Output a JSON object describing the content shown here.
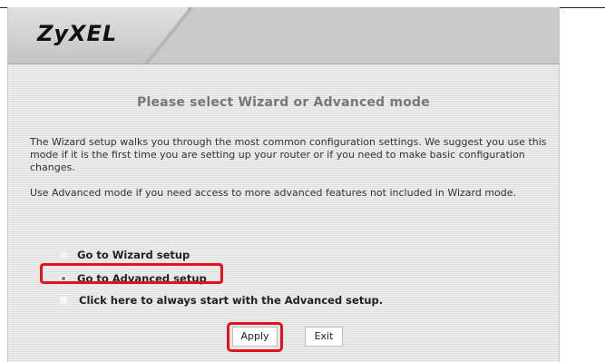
{
  "header": {
    "logo_text": "ZyXEL"
  },
  "main": {
    "heading": "Please select Wizard or Advanced mode",
    "paragraph1": "The Wizard setup walks you through the most common configuration settings. We suggest you use this mode if it is the first time you are setting up your router or if you need to make basic configuration changes.",
    "paragraph2": "Use Advanced mode if you need access to more advanced features not included in Wizard mode.",
    "options": [
      {
        "label": "Go to Wizard setup",
        "selected": false
      },
      {
        "label": "Go to Advanced setup",
        "selected": true
      }
    ],
    "always_advanced": {
      "label": "Click here to always start with the Advanced setup.",
      "checked": false
    }
  },
  "buttons": {
    "apply_label": "Apply",
    "exit_label": "Exit"
  },
  "colors": {
    "highlight": "#e8101a",
    "heading": "#777777"
  }
}
